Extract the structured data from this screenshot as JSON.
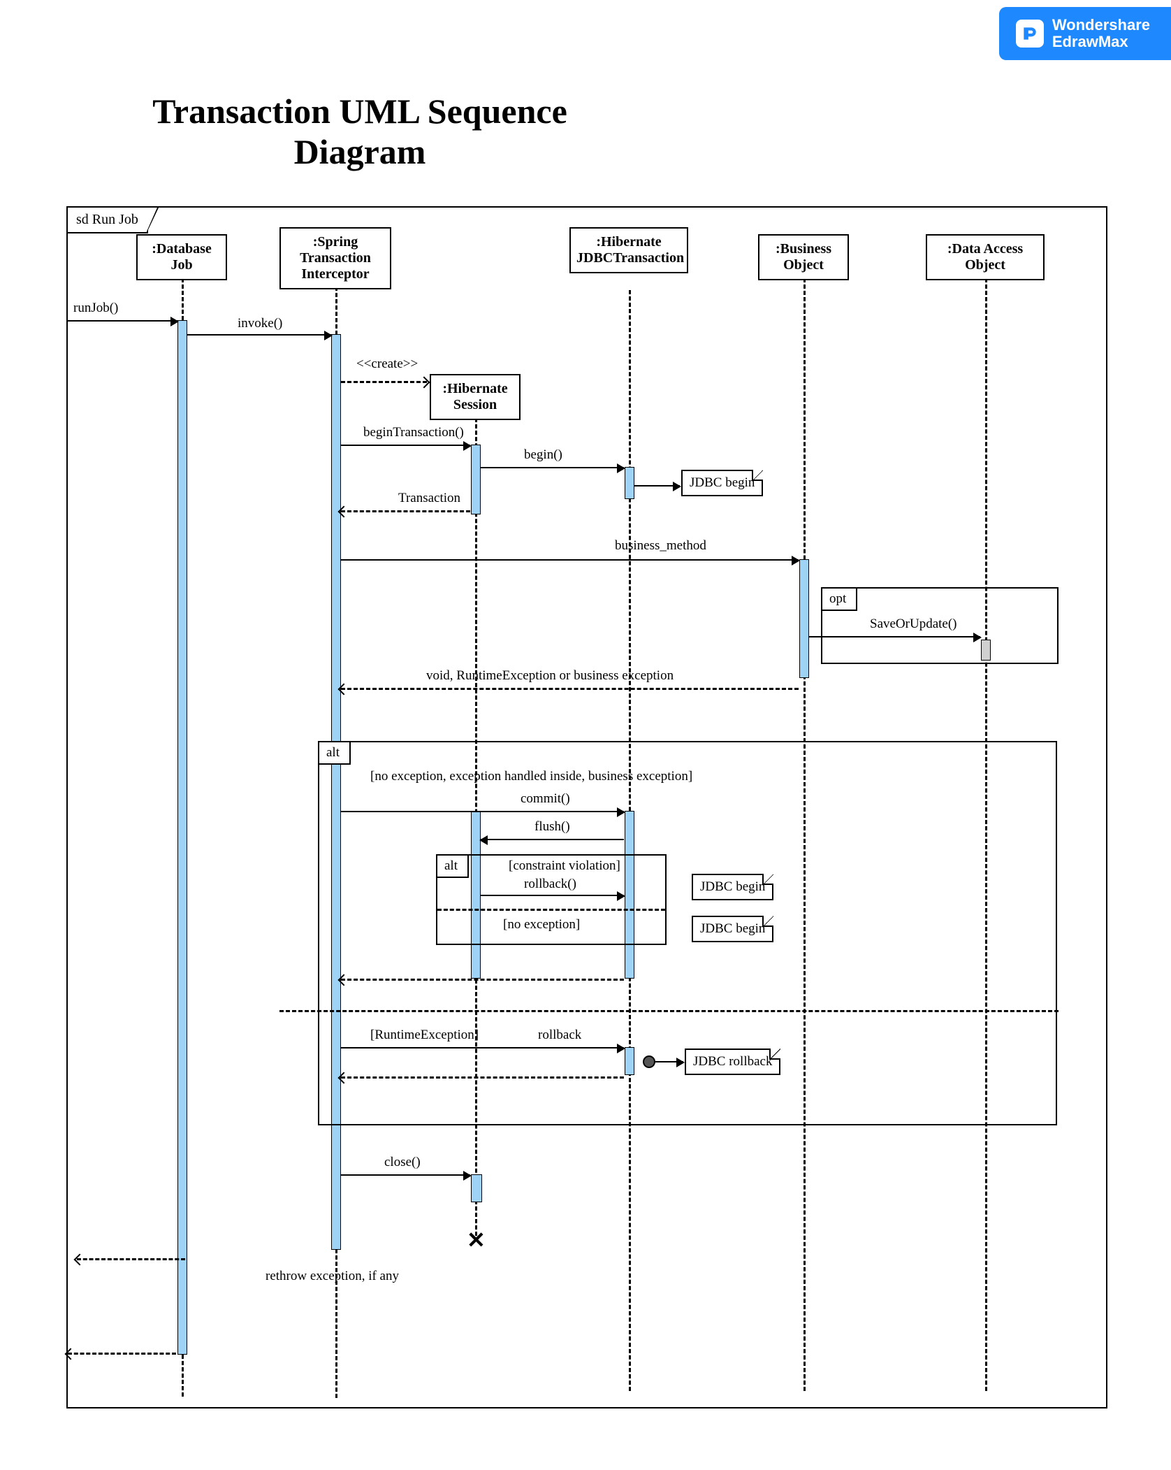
{
  "branding": {
    "line1": "Wondershare",
    "line2": "EdrawMax"
  },
  "title": "Transaction UML Sequence Diagram",
  "frame_label": "sd Run Job",
  "participants": {
    "db_job": ":Database Job",
    "spring": ":Spring Transaction Interceptor",
    "hib_session": ":Hibernate Session",
    "hib_jdbc": ":Hibernate JDBCTransaction",
    "business": ":Business Object",
    "dao": ":Data Access Object"
  },
  "messages": {
    "run_job": "runJob()",
    "invoke": "invoke()",
    "create": "<<create>>",
    "begin_tx": "beginTransaction()",
    "begin": "begin()",
    "jdbc_begin": "JDBC begin",
    "transaction": "Transaction",
    "business_method": "business_method",
    "save_or_update": "SaveOrUpdate()",
    "void_return": "void, RuntimeException or business exception",
    "commit": "commit()",
    "flush": "flush()",
    "rollback": "rollback()",
    "rollback2": "rollback",
    "jdbc_rollback": "JDBC rollback",
    "close": "close()",
    "rethrow": "rethrow exception, if any"
  },
  "fragments": {
    "opt": "opt",
    "alt": "alt",
    "alt_inner": "alt",
    "guard_no_exc": "[no exception, exception handled inside, business exception]",
    "guard_constraint": "[constraint violation]",
    "guard_no_exc2": "[no exception]",
    "guard_runtime": "[RuntimeException]"
  }
}
